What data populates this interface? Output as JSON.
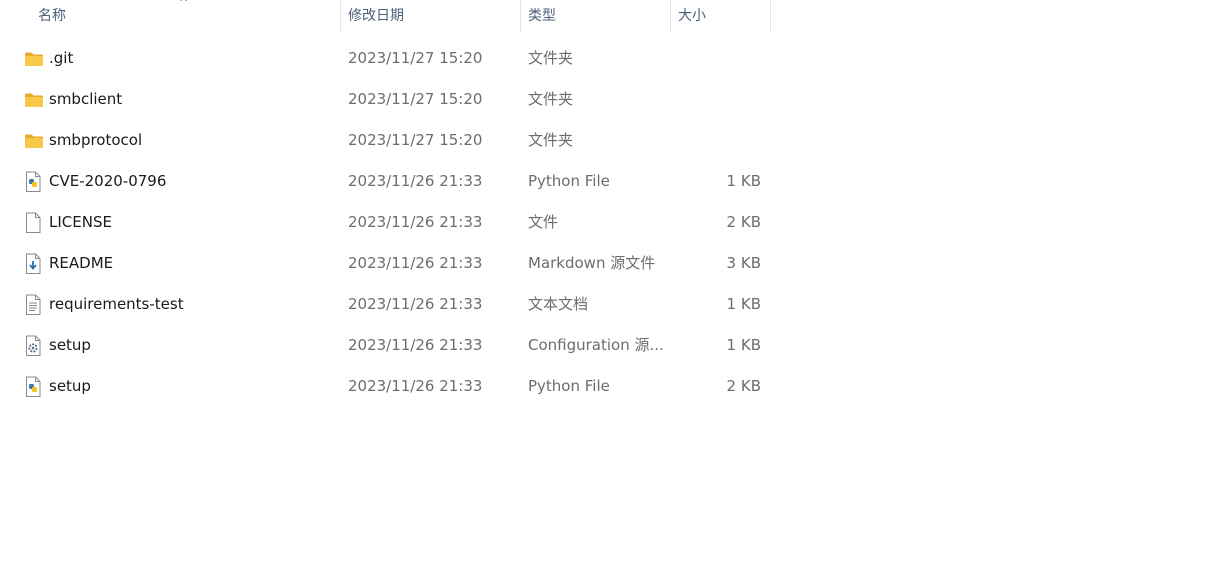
{
  "columns": {
    "name": "名称",
    "modified": "修改日期",
    "type": "类型",
    "size": "大小",
    "sort_indicator": "^"
  },
  "files": [
    {
      "name": ".git",
      "modified": "2023/11/27 15:20",
      "type": "文件夹",
      "size": "",
      "icon": "folder-icon"
    },
    {
      "name": "smbclient",
      "modified": "2023/11/27 15:20",
      "type": "文件夹",
      "size": "",
      "icon": "folder-icon"
    },
    {
      "name": "smbprotocol",
      "modified": "2023/11/27 15:20",
      "type": "文件夹",
      "size": "",
      "icon": "folder-icon"
    },
    {
      "name": "CVE-2020-0796",
      "modified": "2023/11/26 21:33",
      "type": "Python File",
      "size": "1 KB",
      "icon": "python-file-icon"
    },
    {
      "name": "LICENSE",
      "modified": "2023/11/26 21:33",
      "type": "文件",
      "size": "2 KB",
      "icon": "blank-file-icon"
    },
    {
      "name": "README",
      "modified": "2023/11/26 21:33",
      "type": "Markdown 源文件",
      "size": "3 KB",
      "icon": "markdown-file-icon"
    },
    {
      "name": "requirements-test",
      "modified": "2023/11/26 21:33",
      "type": "文本文档",
      "size": "1 KB",
      "icon": "text-file-icon"
    },
    {
      "name": "setup",
      "modified": "2023/11/26 21:33",
      "type": "Configuration 源...",
      "size": "1 KB",
      "icon": "config-file-icon"
    },
    {
      "name": "setup",
      "modified": "2023/11/26 21:33",
      "type": "Python File",
      "size": "2 KB",
      "icon": "python-file-icon"
    }
  ],
  "colors": {
    "folder": "#f8c84a",
    "header_text": "#4c607a",
    "secondary_text": "#6d6d6d"
  }
}
